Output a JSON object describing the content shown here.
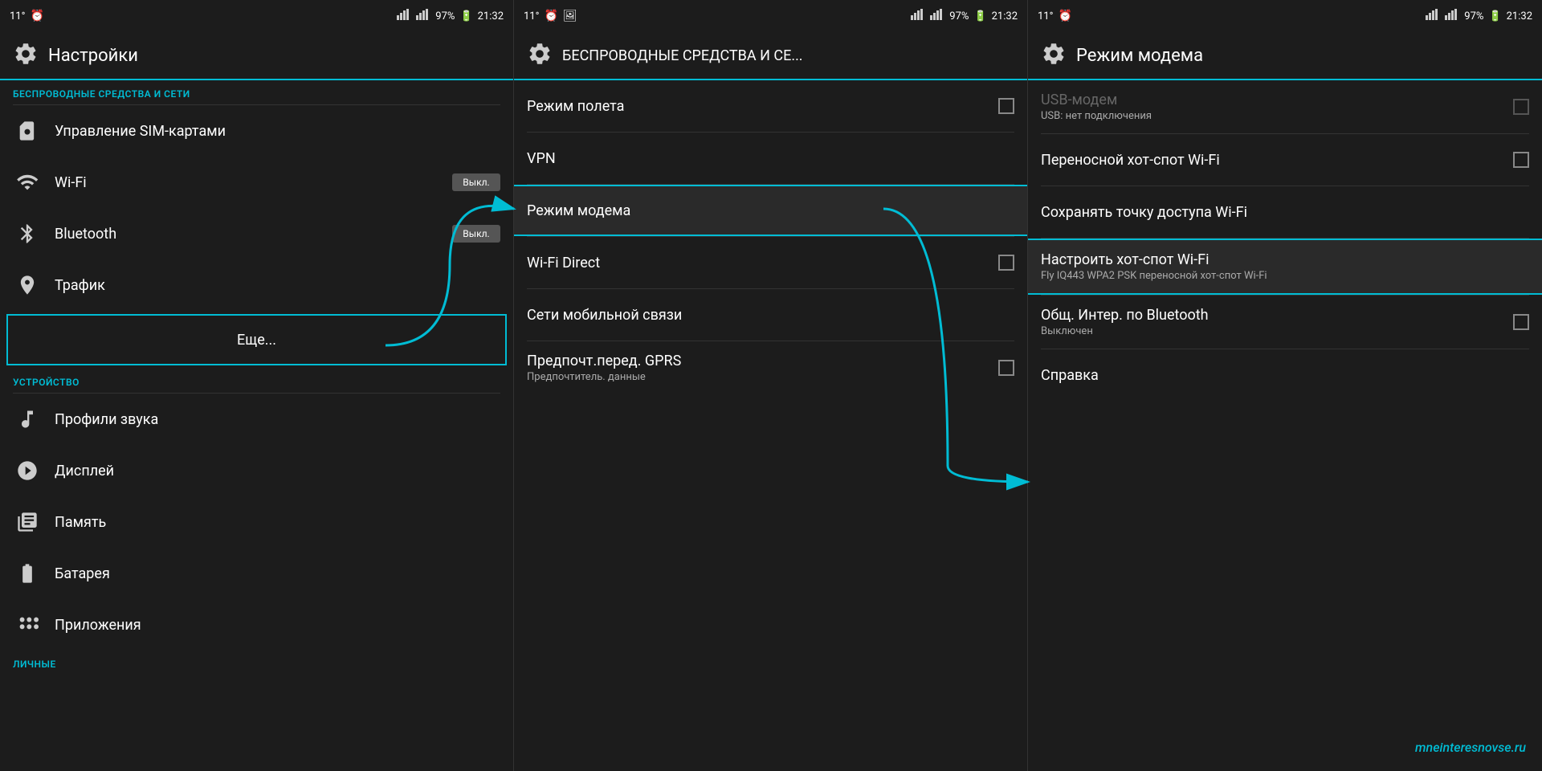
{
  "panel1": {
    "statusBar": {
      "left": "11°",
      "signal1": "▲▲",
      "signal2": "▲▲",
      "battery": "97%",
      "time": "21:32"
    },
    "title": "Настройки",
    "section1": "БЕСПРОВОДНЫЕ СРЕДСТВА И СЕТИ",
    "items": [
      {
        "id": "sim",
        "text": "Управление SIM-картами",
        "icon": "sim",
        "toggle": null
      },
      {
        "id": "wifi",
        "text": "Wi-Fi",
        "icon": "wifi",
        "toggle": "Выкл."
      },
      {
        "id": "bluetooth",
        "text": "Bluetooth",
        "icon": "bluetooth",
        "toggle": "Выкл."
      },
      {
        "id": "traffic",
        "text": "Трафик",
        "icon": "traffic",
        "toggle": null
      },
      {
        "id": "more",
        "text": "Еще...",
        "icon": null,
        "toggle": null,
        "highlighted": true
      }
    ],
    "section2": "УСТРОЙСТВО",
    "items2": [
      {
        "id": "profiles",
        "text": "Профили звука",
        "icon": "sound"
      },
      {
        "id": "display",
        "text": "Дисплей",
        "icon": "display"
      },
      {
        "id": "memory",
        "text": "Память",
        "icon": "memory"
      },
      {
        "id": "battery",
        "text": "Батарея",
        "icon": "battery"
      },
      {
        "id": "apps",
        "text": "Приложения",
        "icon": "apps"
      }
    ],
    "section3": "ЛИЧНЫЕ"
  },
  "panel2": {
    "statusBar": {
      "left": "11°",
      "time": "21:32"
    },
    "title": "БЕСПРОВОДНЫЕ СРЕДСТВА И СЕ...",
    "items": [
      {
        "id": "airplane",
        "text": "Режим полета",
        "sub": null,
        "checkbox": true,
        "selected": false
      },
      {
        "id": "vpn",
        "text": "VPN",
        "sub": null,
        "checkbox": false,
        "selected": false
      },
      {
        "id": "modem",
        "text": "Режим модема",
        "sub": null,
        "checkbox": false,
        "selected": true
      },
      {
        "id": "wifidirect",
        "text": "Wi-Fi Direct",
        "sub": null,
        "checkbox": true,
        "selected": false
      },
      {
        "id": "mobile",
        "text": "Сети мобильной связи",
        "sub": null,
        "checkbox": false,
        "selected": false
      },
      {
        "id": "gprs",
        "text": "Предпочт.перед. GPRS",
        "sub": "Предпочтитель. данные",
        "checkbox": true,
        "selected": false
      }
    ]
  },
  "panel3": {
    "statusBar": {
      "left": "11°",
      "time": "21:32"
    },
    "title": "Режим модема",
    "items": [
      {
        "id": "usb",
        "text": "USB-модем",
        "sub": "USB: нет подключения",
        "checkbox": true,
        "disabled": true,
        "selected": false
      },
      {
        "id": "hotspot",
        "text": "Переносной хот-спот Wi-Fi",
        "sub": null,
        "checkbox": true,
        "disabled": false,
        "selected": false
      },
      {
        "id": "save",
        "text": "Сохранять точку доступа Wi-Fi",
        "sub": null,
        "checkbox": false,
        "disabled": false,
        "selected": false
      },
      {
        "id": "configure",
        "text": "Настроить хот-спот Wi-Fi",
        "sub": "Fly IQ443 WPA2 PSK переносной хот-спот Wi-Fi",
        "checkbox": false,
        "disabled": false,
        "selected": true
      },
      {
        "id": "bluetooth-share",
        "text": "Общ. Интер. по Bluetooth",
        "sub": "Выключен",
        "checkbox": true,
        "disabled": false,
        "selected": false
      },
      {
        "id": "help",
        "text": "Справка",
        "sub": null,
        "checkbox": false,
        "disabled": false,
        "selected": false
      }
    ],
    "website": "mneinteresnovse.ru"
  },
  "arrows": {
    "arrow1_label": "Стрелка от Еще... к Режим модема",
    "arrow2_label": "Стрелка от Режим модема к Настроить хот-спот Wi-Fi"
  }
}
